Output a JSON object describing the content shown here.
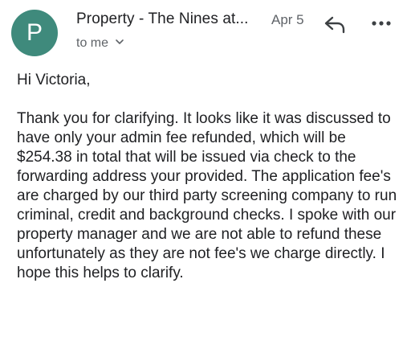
{
  "email": {
    "avatar_letter": "P",
    "avatar_color": "#3f8a7c",
    "sender": "Property -  The Nines at...",
    "date": "Apr 5",
    "recipient_line": "to me",
    "greeting": "Hi Victoria,",
    "body": "Thank you for clarifying. It looks like it was discussed to have only your admin fee refunded, which will be $254.38 in total that will be issued via check to the forwarding address your provided. The application fee's are charged by our third party screening company to run criminal, credit and background checks. I spoke with our property manager and we are not able to refund these unfortunately as they are not fee's we charge directly. I hope this helps to clarify."
  },
  "icons": {
    "reply": "reply-arrow-icon",
    "more": "more-options-icon",
    "expand": "chevron-down-icon"
  }
}
